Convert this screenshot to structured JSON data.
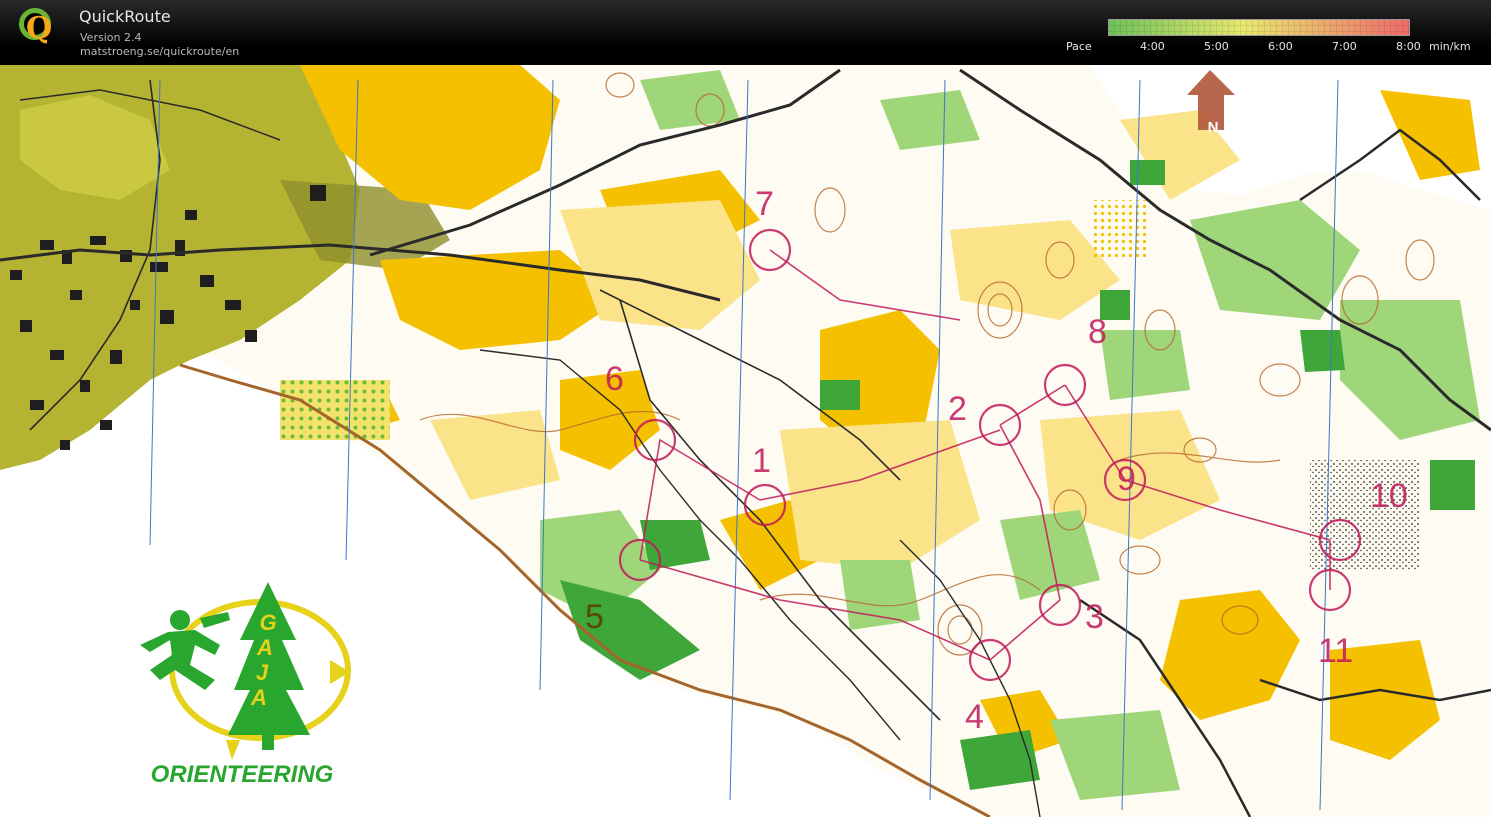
{
  "app": {
    "title": "QuickRoute",
    "version": "Version 2.4",
    "url": "matstroeng.se/quickroute/en",
    "logo_letter": "Q"
  },
  "pace_scale": {
    "label": "Pace",
    "ticks": [
      "4:00",
      "5:00",
      "6:00",
      "7:00",
      "8:00"
    ],
    "unit": "min/km",
    "colors": {
      "fast": "#6dc15a",
      "mid": "#e8e870",
      "slow": "#f06a6a"
    }
  },
  "map": {
    "north_label": "N",
    "controls": [
      "1",
      "2",
      "3",
      "4",
      "5",
      "6",
      "7",
      "8",
      "9",
      "10",
      "11"
    ],
    "club_logo": {
      "letters": [
        "G",
        "A",
        "J",
        "A"
      ],
      "name": "ORIENTEERING"
    },
    "colors": {
      "open_yellow": "#f4c000",
      "rough_yellow": "#fbe38a",
      "forest_green": "#9fd67a",
      "dark_green": "#3fa63a",
      "urban_olive": "#a8a82a",
      "course_magenta": "#c2185b",
      "contour_brown": "#b7652a",
      "north_arrow": "#b0573a"
    }
  }
}
